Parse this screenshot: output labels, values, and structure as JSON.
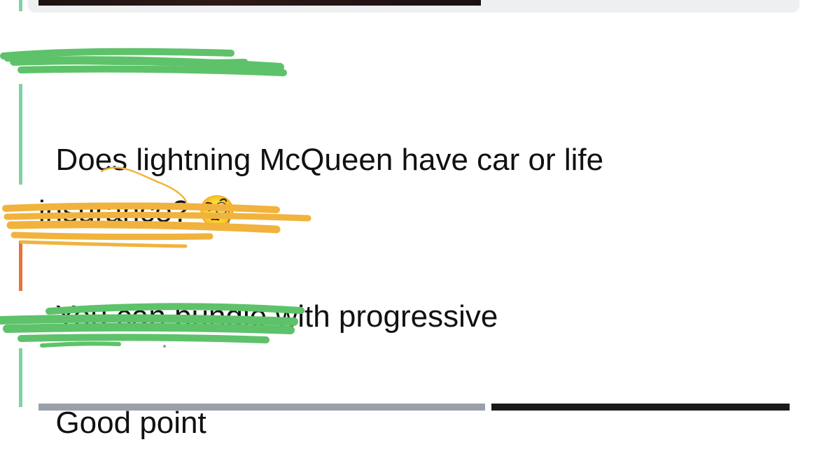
{
  "chat": {
    "messages": [
      {
        "author_color": "green",
        "text": "Does lightning McQueen have car or life insurance? 🧐"
      },
      {
        "author_color": "orange",
        "text": "You can bundle with progressive"
      },
      {
        "author_color": "green",
        "text": "Good point"
      }
    ]
  },
  "colors": {
    "green_bar": "#7fd3a4",
    "orange_bar": "#e4743a",
    "green_scribble": "#5ec26a",
    "orange_scribble": "#f1b33d"
  },
  "icons": {
    "emoji": "face-with-monocle-icon"
  }
}
